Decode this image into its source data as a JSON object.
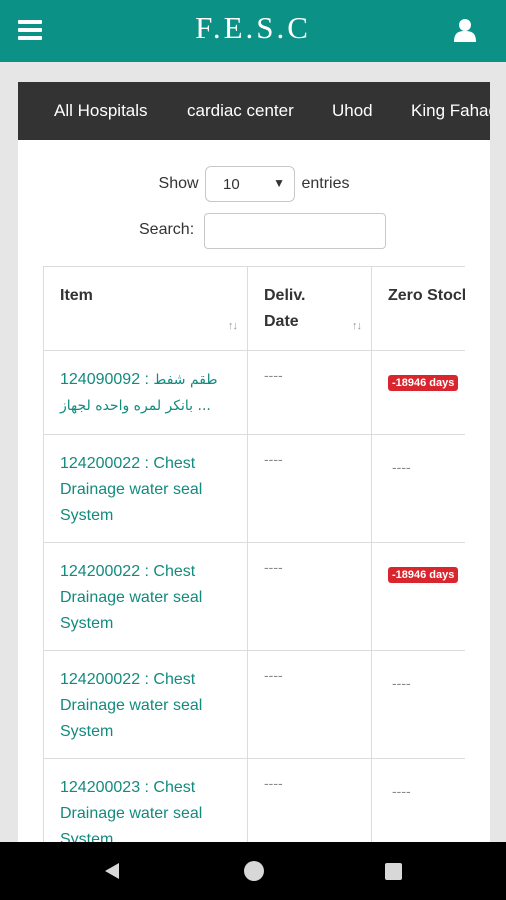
{
  "app": {
    "title": "F.E.S.C"
  },
  "icons": {
    "menu": "menu-icon",
    "user": "user-icon",
    "back": "back-icon",
    "home": "home-icon",
    "recent": "recent-apps-icon"
  },
  "colors": {
    "app_bar": "#0b9186",
    "tabbar": "#333333",
    "link": "#138a7e",
    "badge": "#d9262e"
  },
  "tabs": [
    "All Hospitals",
    "cardiac center",
    "Uhod",
    "King Fahad"
  ],
  "controls": {
    "show_label": "Show",
    "entries_value": "10",
    "entries_label": "entries",
    "search_label": "Search:",
    "search_value": ""
  },
  "table": {
    "headers": [
      "Item",
      "Deliv. Date",
      "Zero Stock"
    ],
    "sort_glyph": "↑↓",
    "rows": [
      {
        "item_code": "124090092 : ",
        "item_name_line1": "طقم شفط",
        "item_name_line2": "بانكر لمره واحده لجهاز ...",
        "deliv_date": "----",
        "zero_stock": "-18946 days",
        "zero_is_badge": true
      },
      {
        "item_code": "124200022 : ",
        "item_name_line1": "Chest",
        "item_name_line2": "Drainage water seal",
        "item_name_line3": "System",
        "deliv_date": "----",
        "zero_stock": "----",
        "zero_is_badge": false
      },
      {
        "item_code": "124200022 : ",
        "item_name_line1": "Chest",
        "item_name_line2": "Drainage water seal",
        "item_name_line3": "System",
        "deliv_date": "----",
        "zero_stock": "-18946 days",
        "zero_is_badge": true
      },
      {
        "item_code": "124200022 : ",
        "item_name_line1": "Chest",
        "item_name_line2": "Drainage water seal",
        "item_name_line3": "System",
        "deliv_date": "----",
        "zero_stock": "----",
        "zero_is_badge": false
      },
      {
        "item_code": "124200023 : ",
        "item_name_line1": "Chest",
        "item_name_line2": "Drainage water seal",
        "item_name_line3": "System",
        "deliv_date": "----",
        "zero_stock": "----",
        "zero_is_badge": false
      }
    ]
  }
}
